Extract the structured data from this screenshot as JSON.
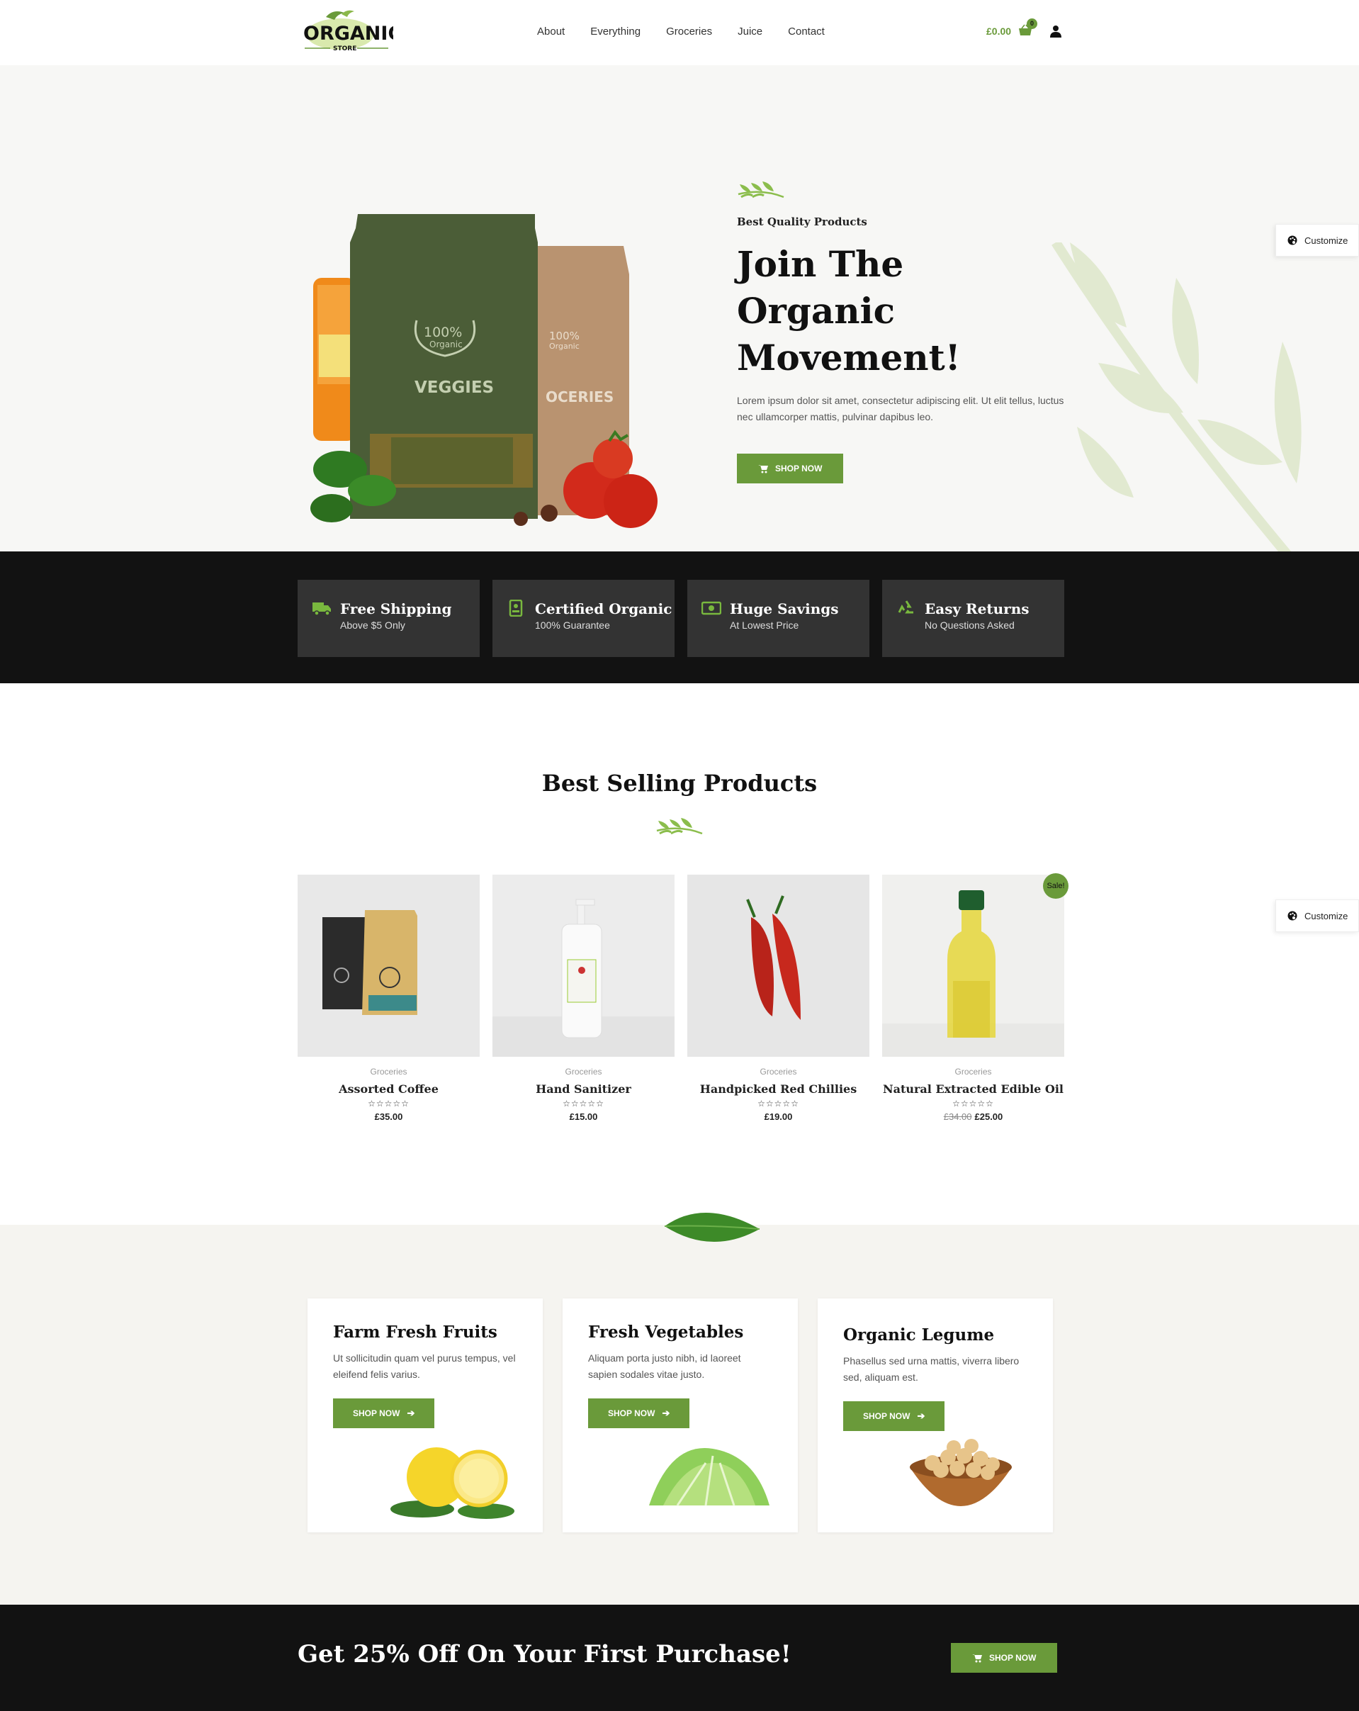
{
  "header": {
    "logo_text": "ORGANIC",
    "logo_sub": "STORE",
    "nav": [
      "About",
      "Everything",
      "Groceries",
      "Juice",
      "Contact"
    ],
    "cart_total": "£0.00",
    "cart_count": "0"
  },
  "hero": {
    "eyebrow": "Best Quality Products",
    "title": "Join The Organic Movement!",
    "description": "Lorem ipsum dolor sit amet, consectetur adipiscing elit. Ut elit tellus, luctus nec ullamcorper mattis, pulvinar dapibus leo.",
    "button": "SHOP NOW",
    "bag_front_line1": "100%",
    "bag_front_line2": "Organic",
    "bag_front_label": "VEGGIES",
    "bag_back_line1": "100%",
    "bag_back_line2": "Organic",
    "bag_back_label": "OCERIES"
  },
  "features": [
    {
      "title": "Free Shipping",
      "sub": "Above $5 Only"
    },
    {
      "title": "Certified Organic",
      "sub": "100% Guarantee"
    },
    {
      "title": "Huge Savings",
      "sub": "At Lowest Price"
    },
    {
      "title": "Easy Returns",
      "sub": "No Questions Asked"
    }
  ],
  "best": {
    "title": "Best Selling Products",
    "products": [
      {
        "category": "Groceries",
        "name": "Assorted Coffee",
        "price": "£35.00",
        "old_price": "",
        "rating": "☆☆☆☆☆"
      },
      {
        "category": "Groceries",
        "name": "Hand Sanitizer",
        "price": "£15.00",
        "old_price": "",
        "rating": "☆☆☆☆☆"
      },
      {
        "category": "Groceries",
        "name": "Handpicked Red Chillies",
        "price": "£19.00",
        "old_price": "",
        "rating": "☆☆☆☆☆"
      },
      {
        "category": "Groceries",
        "name": "Natural Extracted Edible Oil",
        "price": "£25.00",
        "old_price": "£34.00",
        "rating": "☆☆☆☆☆",
        "badge": "Sale!"
      }
    ]
  },
  "categories": [
    {
      "title": "Farm Fresh Fruits",
      "desc": "Ut sollicitudin quam vel purus tempus, vel eleifend felis varius.",
      "button": "SHOP NOW"
    },
    {
      "title": "Fresh Vegetables",
      "desc": "Aliquam porta justo nibh, id laoreet sapien sodales vitae justo.",
      "button": "SHOP NOW"
    },
    {
      "title": "Organic Legume",
      "desc": "Phasellus sed urna mattis, viverra libero sed, aliquam est.",
      "button": "SHOP NOW"
    }
  ],
  "promo": {
    "title": "Get 25% Off On Your First Purchase!",
    "button": "SHOP NOW"
  },
  "customize_label": "Customize",
  "colors": {
    "accent": "#6a9a3a",
    "dark": "#121212",
    "hero_bg": "#f7f7f5"
  }
}
